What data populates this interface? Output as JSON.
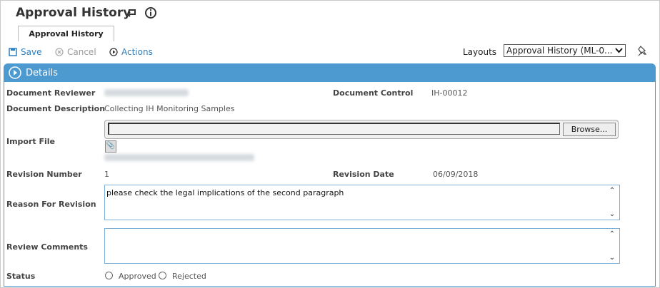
{
  "page": {
    "title": "Approval History",
    "tab_label": "Approval History"
  },
  "toolbar": {
    "save_label": "Save",
    "cancel_label": "Cancel",
    "actions_label": "Actions",
    "layouts_label": "Layouts",
    "layouts_selected": "Approval History (ML-0..."
  },
  "section": {
    "title": "Details"
  },
  "fields": {
    "document_reviewer_label": "Document Reviewer",
    "document_control_label": "Document Control",
    "document_control_value": "IH-00012",
    "document_description_label": "Document Description",
    "document_description_value": "Collecting IH Monitoring Samples",
    "import_file_label": "Import File",
    "browse_label": "Browse...",
    "revision_number_label": "Revision Number",
    "revision_number_value": "1",
    "revision_date_label": "Revision Date",
    "revision_date_value": "06/09/2018",
    "reason_for_revision_label": "Reason For Revision",
    "reason_for_revision_value": "please check the legal implications of the second paragraph",
    "review_comments_label": "Review Comments",
    "review_comments_value": "",
    "status_label": "Status",
    "status_options": [
      "Approved",
      "Rejected"
    ]
  },
  "icons": {
    "undo": "undo-icon",
    "info": "info-icon",
    "save": "save-icon",
    "cancel": "cancel-icon",
    "actions": "play-circle-icon",
    "pin": "pin-icon",
    "section": "play-circle-icon",
    "attachment": "paperclip-icon"
  },
  "colors": {
    "accent": "#4d9ad1",
    "link": "#2f7fbf"
  }
}
